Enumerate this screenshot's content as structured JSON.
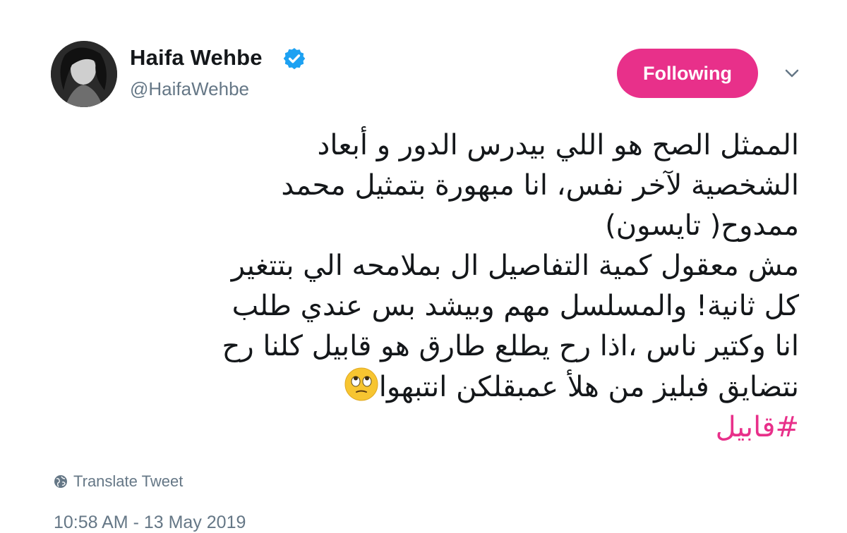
{
  "author": {
    "name": "Haifa Wehbe",
    "handle": "@HaifaWehbe",
    "verified": true,
    "avatar": "profile-photo"
  },
  "follow_button": {
    "label": "Following",
    "color": "#e8308a"
  },
  "menu_icon": "chevron-down-icon",
  "tweet": {
    "lines": [
      "الممثل الصح هو اللي بيدرس الدور و أبعاد",
      "الشخصية لآخر نفس، انا مبهورة بتمثيل محمد",
      "ممدوح( تايسون)",
      "مش معقول كمية التفاصيل ال بملامحه الي بتتغير",
      "كل ثانية! والمسلسل مهم وبيشد بس عندي طلب",
      "انا وكتير ناس ،اذا رح يطلع طارق هو قابيل كلنا رح",
      "نتضايق فبليز من هلأ عمبقلكن انتبهوا"
    ],
    "emoji": "face-with-rolling-eyes",
    "hashtag": "#قابيل",
    "hashtag_color": "#e8308a"
  },
  "translate": {
    "label": "Translate Tweet",
    "icon": "globe-icon"
  },
  "timestamp": "10:58 AM - 13 May 2019"
}
